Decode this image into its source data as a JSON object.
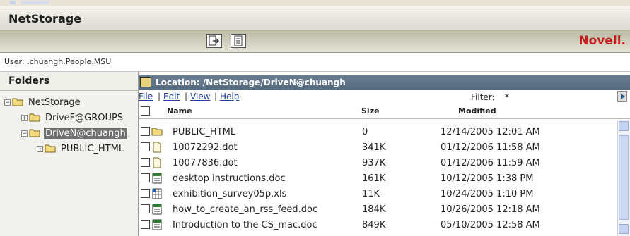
{
  "app": {
    "title": "NetStorage",
    "brand": "Novell."
  },
  "colors": {
    "brand_red": "#c41f1f",
    "location_bar": "#5f7386",
    "selected_tree": "#707070",
    "link_blue": "#1a3fa0"
  },
  "toolbar": {
    "buttons": [
      {
        "icon": "upload-icon"
      },
      {
        "icon": "document-properties-icon"
      }
    ]
  },
  "user": {
    "label": "User: .chuangh.People.MSU"
  },
  "folders": {
    "heading": "Folders",
    "tree": [
      {
        "label": "NetStorage",
        "expander": "−",
        "selected": false
      },
      {
        "label": "DriveF@GROUPS",
        "expander": "+",
        "selected": false
      },
      {
        "label": "DriveN@chuangh",
        "expander": "−",
        "selected": true
      },
      {
        "label": "PUBLIC_HTML",
        "expander": "+",
        "selected": false
      }
    ]
  },
  "location": {
    "text": "Location: /NetStorage/DriveN@chuangh"
  },
  "menu": {
    "file": "File",
    "edit": "Edit",
    "view": "View",
    "help": "Help",
    "sep": "|"
  },
  "filter": {
    "label": "Filter:",
    "value": "*"
  },
  "columns": {
    "name": "Name",
    "size": "Size",
    "modified": "Modified"
  },
  "files": [
    {
      "name": "PUBLIC_HTML",
      "size": "0",
      "modified": "12/14/2005 12:01 AM",
      "type": "folder"
    },
    {
      "name": "10072292.dot",
      "size": "341K",
      "modified": "01/12/2006 11:58 AM",
      "type": "template"
    },
    {
      "name": "10077836.dot",
      "size": "937K",
      "modified": "01/12/2006 11:59 AM",
      "type": "template"
    },
    {
      "name": "desktop instructions.doc",
      "size": "161K",
      "modified": "10/12/2005 1:38 PM",
      "type": "doc"
    },
    {
      "name": "exhibition_survey05p.xls",
      "size": "11K",
      "modified": "10/24/2005 1:10 PM",
      "type": "xls"
    },
    {
      "name": "how_to_create_an_rss_feed.doc",
      "size": "184K",
      "modified": "10/26/2005 12:18 AM",
      "type": "doc"
    },
    {
      "name": "Introduction to the CS_mac.doc",
      "size": "849K",
      "modified": "05/10/2005 12:58 AM",
      "type": "doc"
    }
  ]
}
